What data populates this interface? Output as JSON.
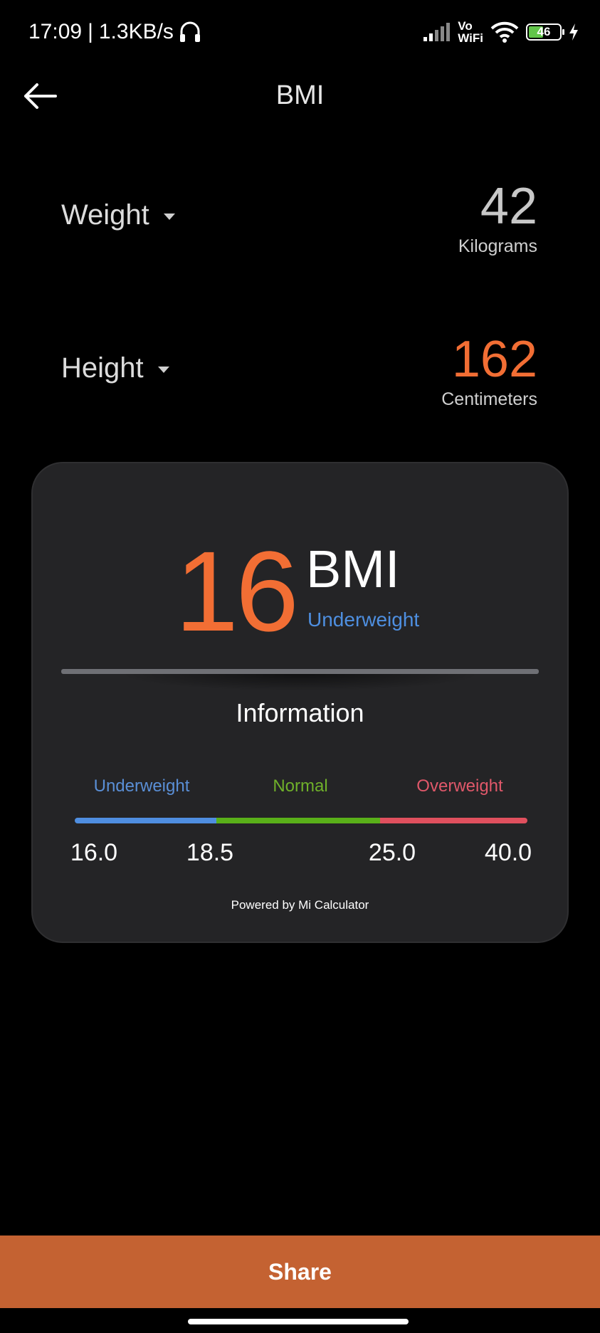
{
  "status_bar": {
    "time": "17:09",
    "separator": "|",
    "network_speed": "1.3KB/s",
    "vowifi_top": "Vo",
    "vowifi_bottom": "WiFi",
    "battery_level": "46",
    "icons": [
      "headset-icon",
      "signal-icon",
      "vowifi-icon",
      "wifi-icon",
      "battery-icon",
      "charging-icon"
    ]
  },
  "header": {
    "title": "BMI",
    "back_icon": "arrow-left-icon"
  },
  "weight": {
    "label": "Weight",
    "value": "42",
    "unit": "Kilograms",
    "value_color": "#c8c8c8"
  },
  "height": {
    "label": "Height",
    "value": "162",
    "unit": "Centimeters",
    "value_color": "#f26e34"
  },
  "result": {
    "bmi_value": "16",
    "bmi_label": "BMI",
    "classification": "Underweight"
  },
  "information": {
    "title": "Information",
    "categories": [
      {
        "label": "Underweight",
        "color": "#5a8fd6"
      },
      {
        "label": "Normal",
        "color": "#6fb02a"
      },
      {
        "label": "Overweight",
        "color": "#e0586a"
      }
    ],
    "scale_colors": [
      "#4f8ee0",
      "#59b019",
      "#e0505e"
    ],
    "ticks": [
      "16.0",
      "18.5",
      "25.0",
      "40.0"
    ],
    "powered_by": "Powered by Mi Calculator"
  },
  "footer": {
    "share_label": "Share"
  },
  "colors": {
    "accent": "#f26e34",
    "share_button": "#c46232",
    "card_bg": "#242426",
    "background": "#000000"
  }
}
